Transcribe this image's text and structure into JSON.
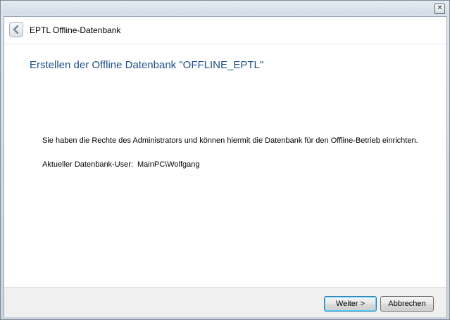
{
  "window": {
    "close_icon": "close-icon",
    "header_title": "EPTL Offline-Datenbank"
  },
  "content": {
    "heading": "Erstellen der Offline Datenbank \"OFFLINE_EPTL\"",
    "info": "Sie haben die Rechte des Administrators und können hiermit die Datenbank für den Offline-Betrieb einrichten.",
    "user_label": "Aktueller Datenbank-User:",
    "user_value": "MainPC\\Wolfgang"
  },
  "footer": {
    "next_label": "Weiter >",
    "cancel_label": "Abbrechen"
  },
  "colors": {
    "heading": "#1e4f88",
    "frame": "#c9d3de"
  }
}
